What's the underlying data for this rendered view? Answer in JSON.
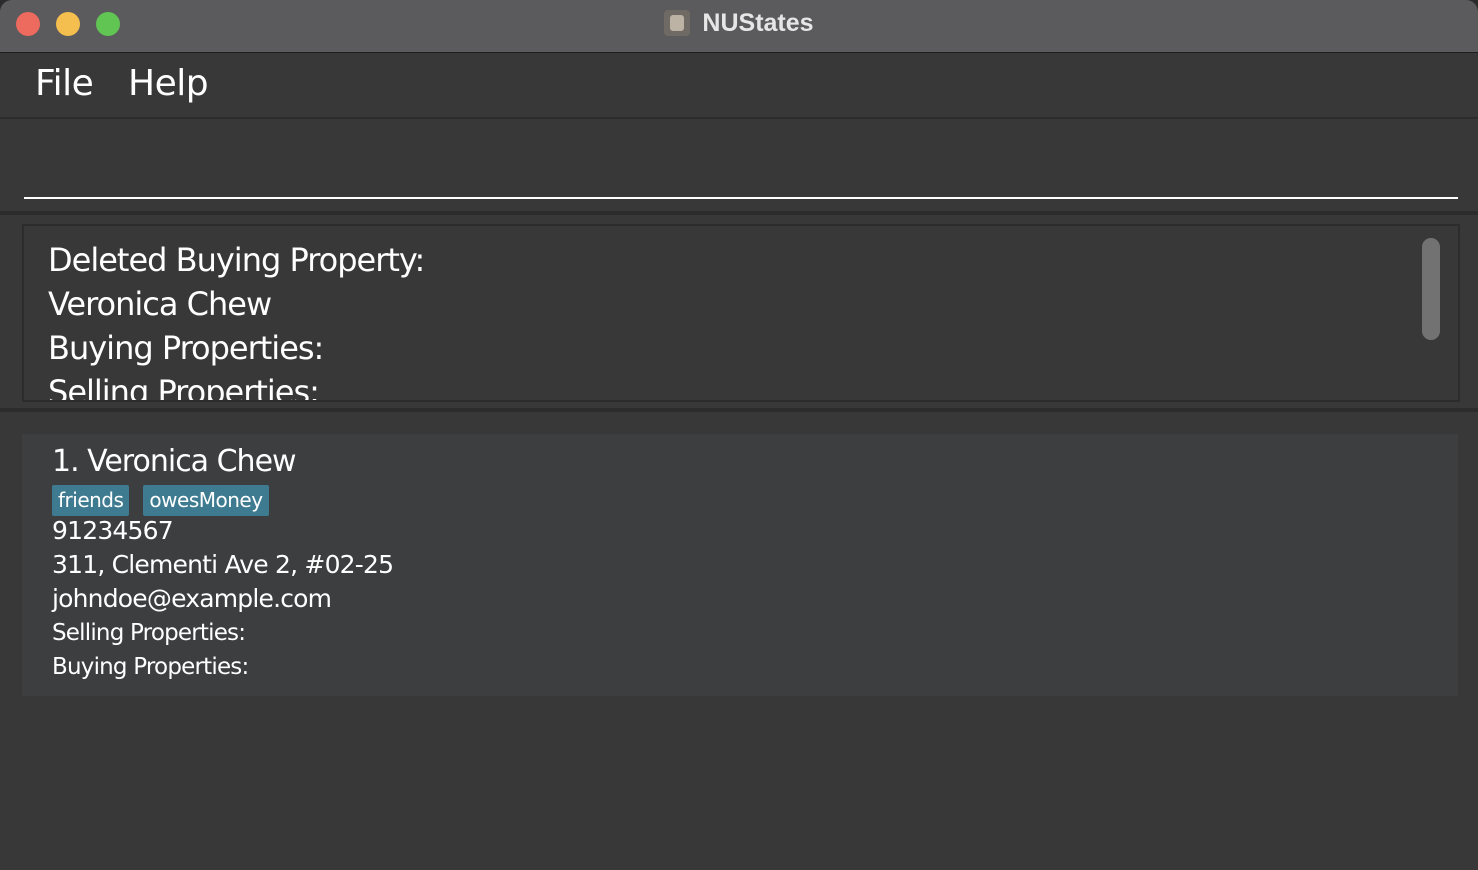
{
  "window": {
    "title": "NUStates"
  },
  "menu": {
    "items": [
      {
        "label": "File"
      },
      {
        "label": "Help"
      }
    ]
  },
  "command_box": {
    "value": "",
    "placeholder": ""
  },
  "result_display": {
    "text": "Deleted Buying Property:\nVeronica Chew\nBuying Properties:\nSelling Properties:"
  },
  "person_list": {
    "persons": [
      {
        "index_name": "1. Veronica Chew",
        "tags": [
          "friends",
          "owesMoney"
        ],
        "phone": "91234567",
        "address": "311, Clementi Ave 2, #02-25",
        "email": "johndoe@example.com",
        "selling_label": "Selling Properties:",
        "buying_label": "Buying Properties:"
      }
    ]
  },
  "colors": {
    "titlebar": "#5b5a5c",
    "background": "#383838",
    "card": "#3c3e3f",
    "tag": "#3e7b91",
    "close": "#ed6a5e",
    "minimize": "#f5bf4f",
    "maximize": "#61c554"
  }
}
